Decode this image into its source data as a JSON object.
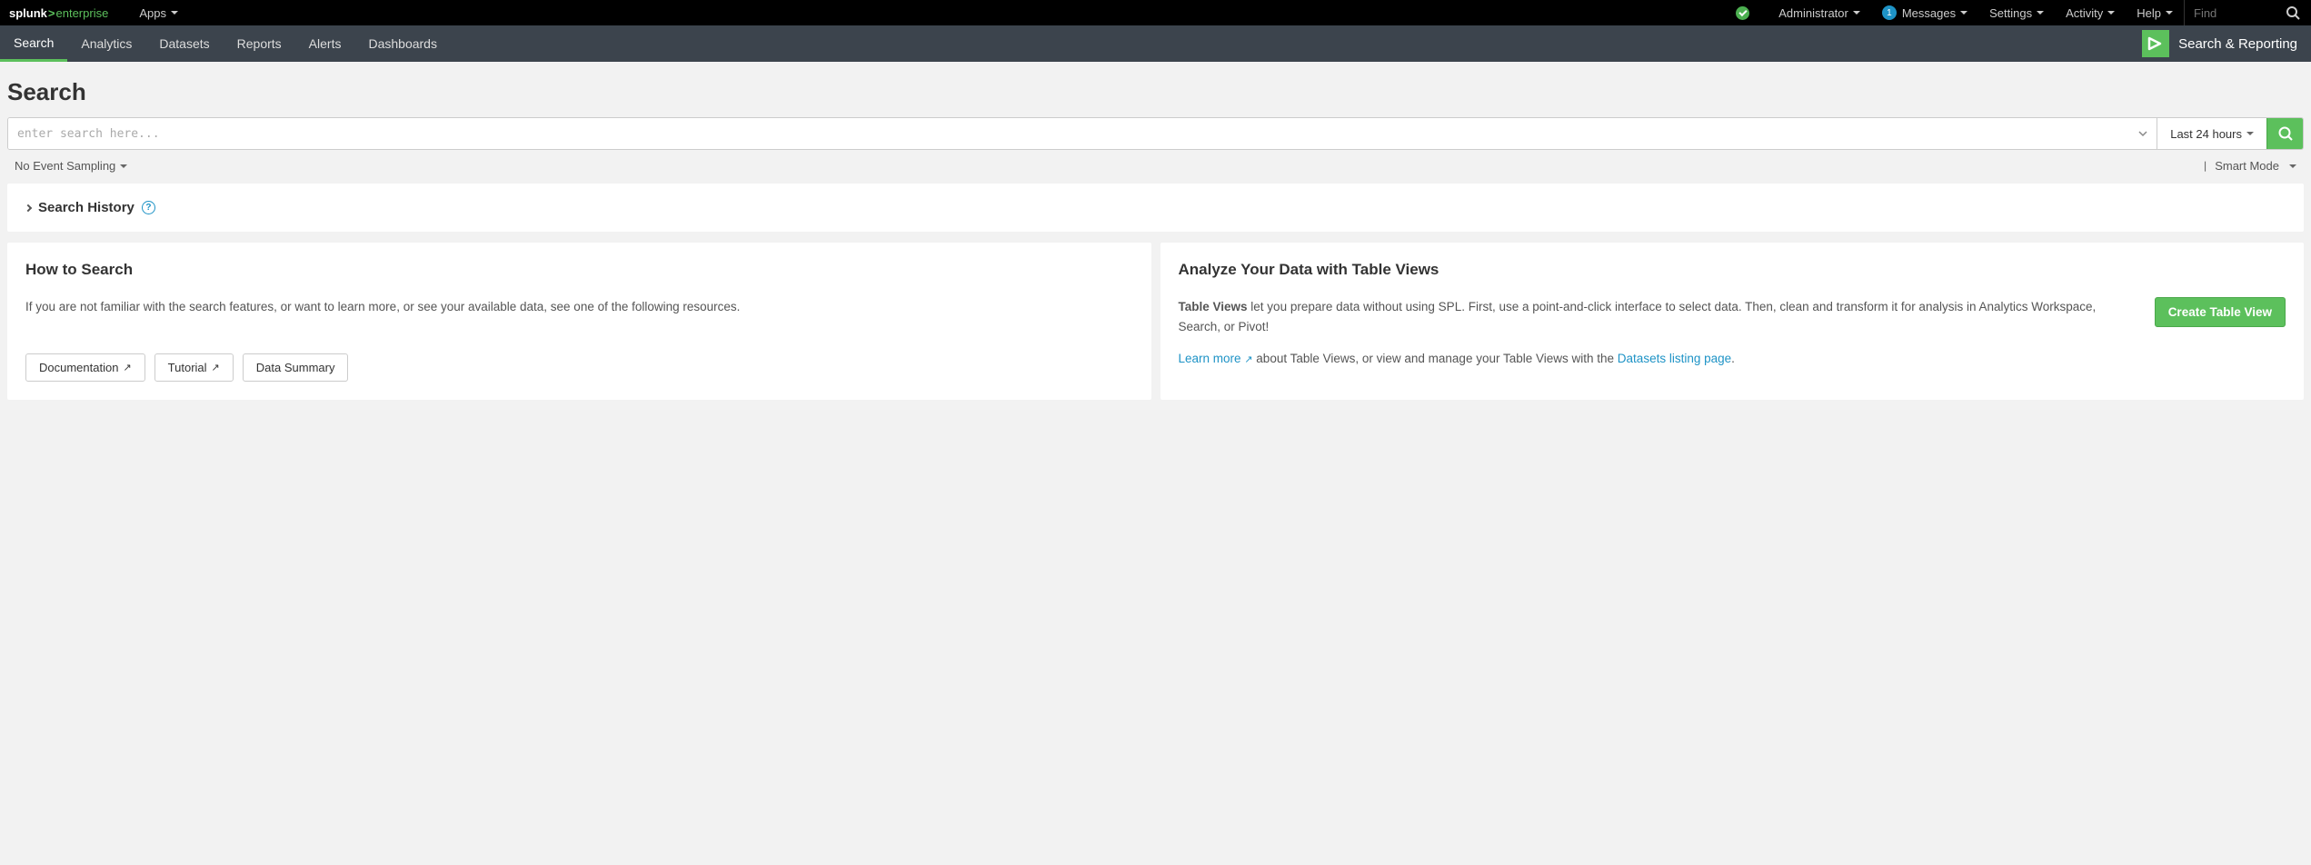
{
  "topbar": {
    "logo_part1": "splunk",
    "logo_gt": ">",
    "logo_part2": "enterprise",
    "apps_label": "Apps",
    "admin_label": "Administrator",
    "messages_label": "Messages",
    "messages_count": "1",
    "settings_label": "Settings",
    "activity_label": "Activity",
    "help_label": "Help",
    "find_placeholder": "Find"
  },
  "subnav": {
    "items": [
      "Search",
      "Analytics",
      "Datasets",
      "Reports",
      "Alerts",
      "Dashboards"
    ],
    "app_label": "Search & Reporting"
  },
  "page": {
    "title": "Search"
  },
  "search": {
    "placeholder": "enter search here...",
    "time_label": "Last 24 hours",
    "sampling_label": "No Event Sampling",
    "mode_label": "Smart Mode"
  },
  "history": {
    "title": "Search History"
  },
  "howto": {
    "title": "How to Search",
    "body": "If you are not familiar with the search features, or want to learn more, or see your available data, see one of the following resources.",
    "btn_documentation": "Documentation",
    "btn_tutorial": "Tutorial",
    "btn_data_summary": "Data Summary"
  },
  "tableviews": {
    "title": "Analyze Your Data with Table Views",
    "lead_bold": "Table Views",
    "lead_rest": " let you prepare data without using SPL. First, use a point-and-click interface to select data. Then, clean and transform it for analysis in Analytics Workspace, Search, or Pivot!",
    "learn_more": "Learn more",
    "mid_text": " about Table Views, or view and manage your Table Views with the ",
    "listing_link": "Datasets listing page",
    "period": ".",
    "create_btn": "Create Table View"
  }
}
